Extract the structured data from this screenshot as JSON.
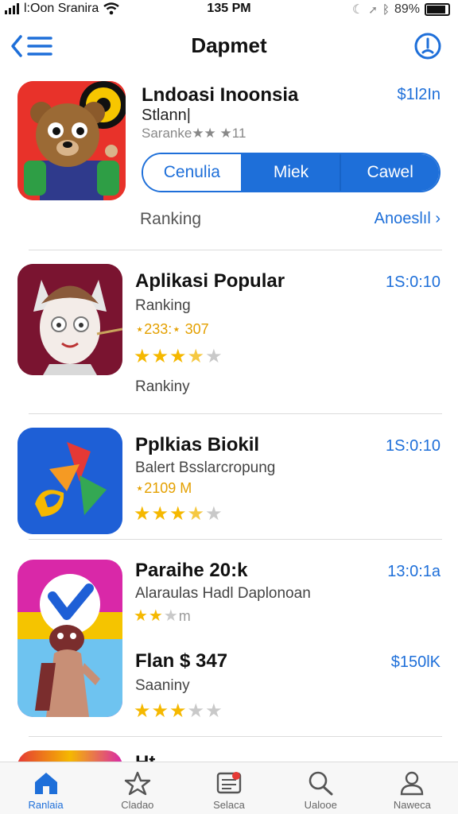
{
  "status_bar": {
    "carrier": "l:Oon Sranira",
    "time": "135 PM",
    "battery": "89%"
  },
  "nav": {
    "title": "Dapmet",
    "back_icon": "back-list-icon",
    "info_icon": "info-icon"
  },
  "featured": {
    "name": "Lndoasi Inoonsia",
    "subtitle": "Stlann|",
    "rating_text": "Saranke★★ ★11",
    "price": "$1l2In",
    "segments": [
      {
        "label": "Cenulia",
        "active": false
      },
      {
        "label": "Miek",
        "active": true
      },
      {
        "label": "Cawel",
        "active": true
      }
    ],
    "ranking_label": "Ranking",
    "ranking_link": "Anoeslıl ›"
  },
  "apps": [
    {
      "name": "Aplikasi Popular",
      "subtitle": "Ranking",
      "rating_text": "⋆233:⋆ 307",
      "stars": 3.5,
      "extra": "Rankiny",
      "price": "1S:0:10"
    },
    {
      "name": "Pplkias Biokil",
      "subtitle": "Balert Bsslarcropung",
      "rating_text": "⋆2109 M",
      "stars": 3.5,
      "price": "1S:0:10"
    },
    {
      "name": "Paraihe 20:k",
      "subtitle": "Alaraulas Hadl Daplonoan",
      "rating_text": "m",
      "stars_mini": 2,
      "second_name": "Flan $ 347",
      "second_subtitle": "Saaniny",
      "stars": 3,
      "price": "13:0:1a",
      "second_price": "$150lK"
    },
    {
      "name": "Ht"
    }
  ],
  "tab_bar": [
    {
      "label": "Ranlaia",
      "icon": "home-icon",
      "active": true
    },
    {
      "label": "Cladao",
      "icon": "star-outline-icon",
      "active": false
    },
    {
      "label": "Selaca",
      "icon": "news-icon",
      "active": false
    },
    {
      "label": "Ualooe",
      "icon": "search-icon",
      "active": false
    },
    {
      "label": "Naweca",
      "icon": "person-icon",
      "active": false
    }
  ],
  "colors": {
    "accent": "#1e6fd9",
    "star": "#f5b800",
    "badge": "#e53935"
  }
}
